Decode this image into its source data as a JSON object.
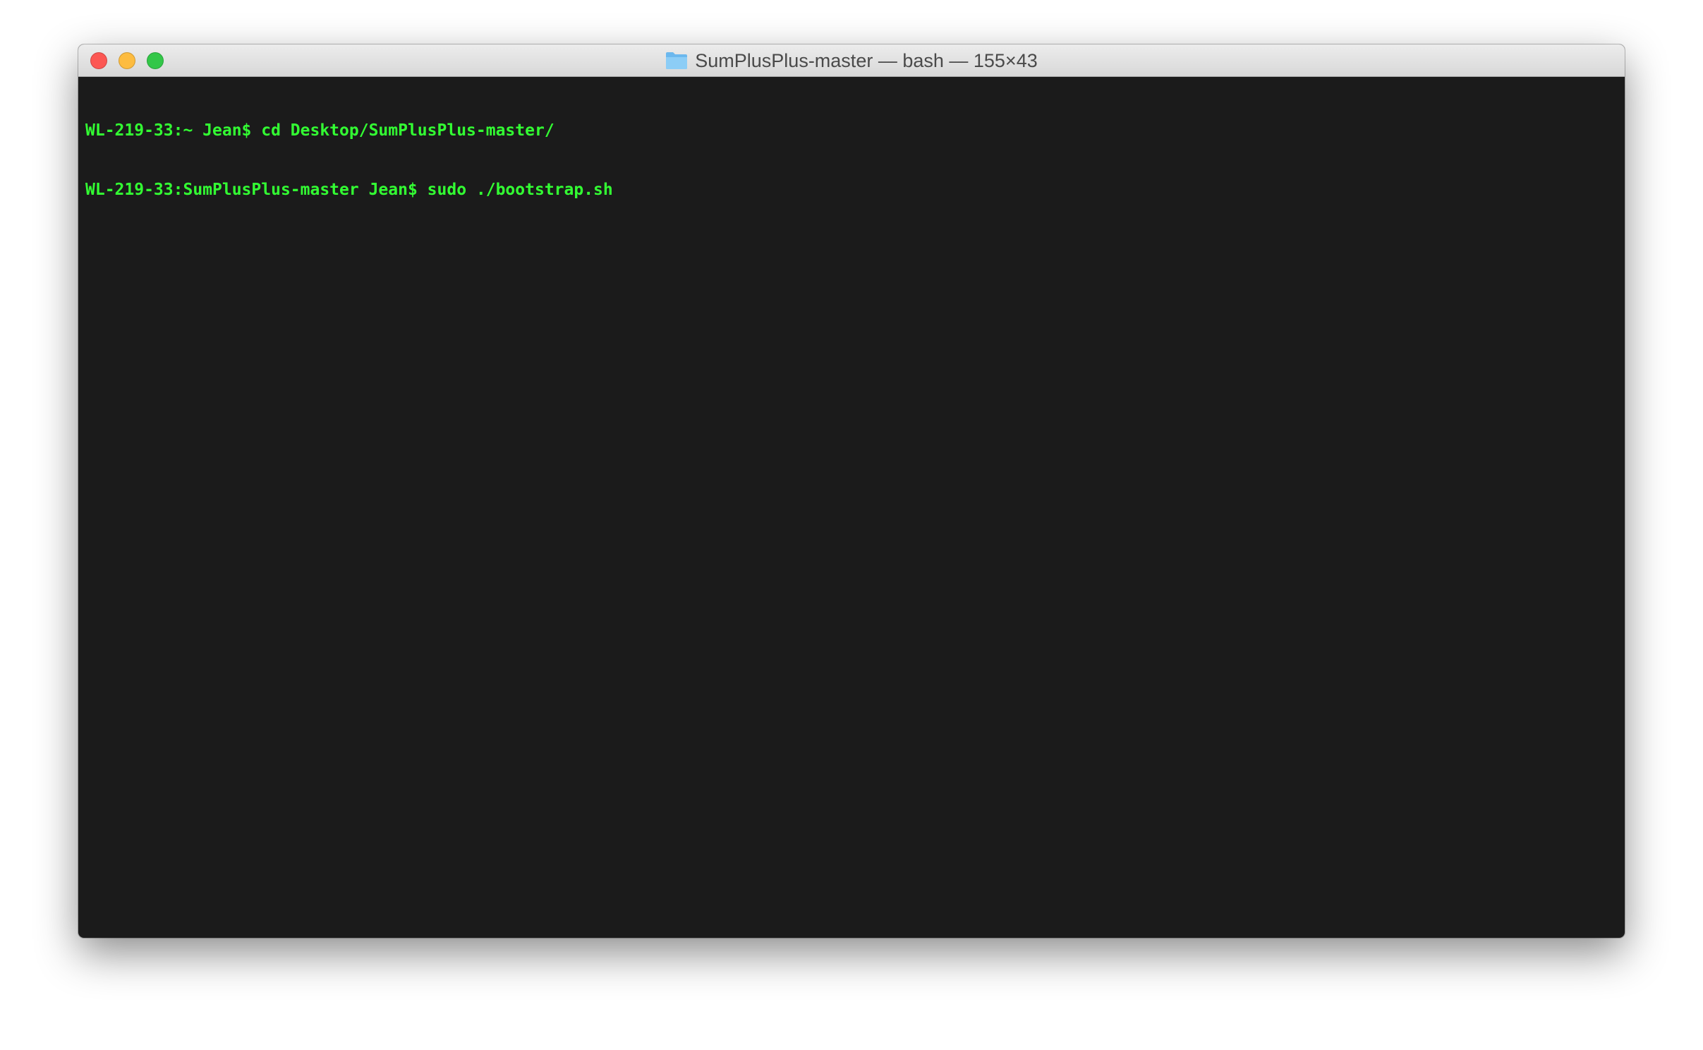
{
  "window": {
    "title": "SumPlusPlus-master — bash — 155×43",
    "title_icon": "folder-icon",
    "traffic_lights": {
      "close_color": "#fc5753",
      "minimize_color": "#fdbc40",
      "zoom_color": "#33c748"
    }
  },
  "terminal": {
    "background_color": "#1b1b1b",
    "text_color": "#33ff33",
    "lines": [
      "WL-219-33:~ Jean$ cd Desktop/SumPlusPlus-master/",
      "WL-219-33:SumPlusPlus-master Jean$ sudo ./bootstrap.sh"
    ]
  }
}
